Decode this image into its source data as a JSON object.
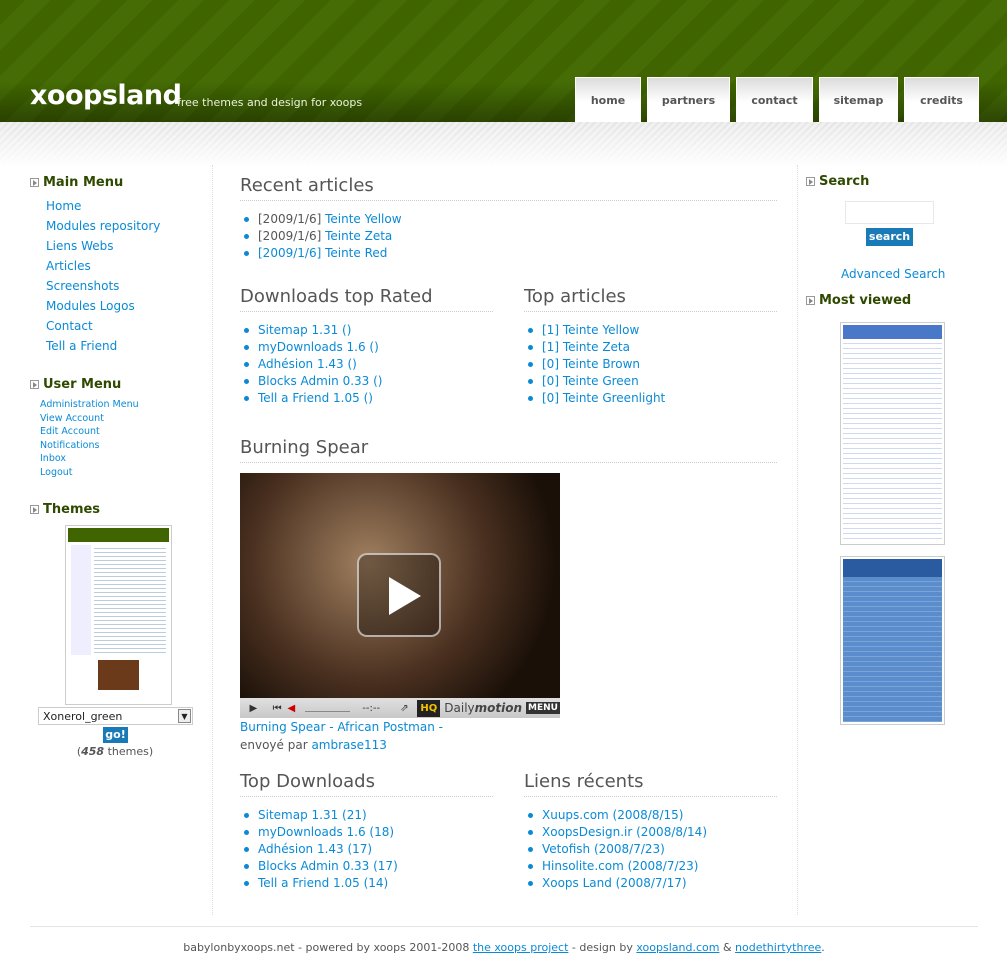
{
  "header": {
    "logo": "xoopsland",
    "slogan": "free themes and design for xoops",
    "nav": [
      "home",
      "partners",
      "contact",
      "sitemap",
      "credits"
    ]
  },
  "left": {
    "main_menu": {
      "title": "Main Menu",
      "items": [
        "Home",
        "Modules repository",
        "Liens Webs",
        "Articles",
        "Screenshots",
        "Modules Logos",
        "Contact",
        "Tell a Friend"
      ]
    },
    "user_menu": {
      "title": "User Menu",
      "items": [
        "Administration Menu",
        "View Account",
        "Edit Account",
        "Notifications",
        "Inbox",
        "Logout"
      ]
    },
    "themes": {
      "title": "Themes",
      "selected": "Xonerol_green",
      "go": "go!",
      "count": "458",
      "count_suffix": " themes)",
      "count_prefix": "("
    }
  },
  "center": {
    "recent": {
      "title": "Recent articles",
      "items": [
        {
          "date": "[2009/1/6] ",
          "link": "Teinte Yellow"
        },
        {
          "date": "[2009/1/6] ",
          "link": "Teinte Zeta"
        },
        {
          "date": "[2009/1/6] Teinte Red",
          "link": ""
        }
      ]
    },
    "top_rated": {
      "title": "Downloads top Rated",
      "items": [
        "Sitemap 1.31 ()",
        "myDownloads 1.6 ()",
        "Adhésion 1.43 ()",
        "Blocks Admin 0.33 ()",
        "Tell a Friend 1.05 ()"
      ]
    },
    "top_articles": {
      "title": "Top articles",
      "items": [
        "[1] Teinte Yellow",
        "[1] Teinte Zeta",
        "[0] Teinte Brown",
        "[0] Teinte Green",
        "[0] Teinte Greenlight"
      ]
    },
    "video": {
      "title": "Burning Spear",
      "link": "Burning Spear - African Postman -",
      "by": "envoyé par ",
      "user": "ambrase113",
      "time": "--:--",
      "hq": "HQ",
      "brand1": "Daily",
      "brand2": "motion",
      "menu": "MENU"
    },
    "top_downloads": {
      "title": "Top Downloads",
      "items": [
        "Sitemap 1.31 (21)",
        "myDownloads 1.6 (18)",
        "Adhésion 1.43 (17)",
        "Blocks Admin 0.33 (17)",
        "Tell a Friend 1.05 (14)"
      ]
    },
    "liens": {
      "title": "Liens récents",
      "items": [
        "Xuups.com (2008/8/15)",
        "XoopsDesign.ir (2008/8/14)",
        "Vetofish (2008/7/23)",
        "Hinsolite.com (2008/7/23)",
        "Xoops Land (2008/7/17)"
      ]
    }
  },
  "right": {
    "search_title": "Search",
    "search_button": "search",
    "advanced": "Advanced Search",
    "most_viewed": "Most viewed"
  },
  "footer": {
    "text1": "babylonbyxoops.net - powered by xoops 2001-2008 ",
    "link1": "the xoops project",
    "text2": " - design by ",
    "link2": "xoopsland.com",
    "text3": " & ",
    "link3": "nodethirtythree",
    "text4": "."
  }
}
